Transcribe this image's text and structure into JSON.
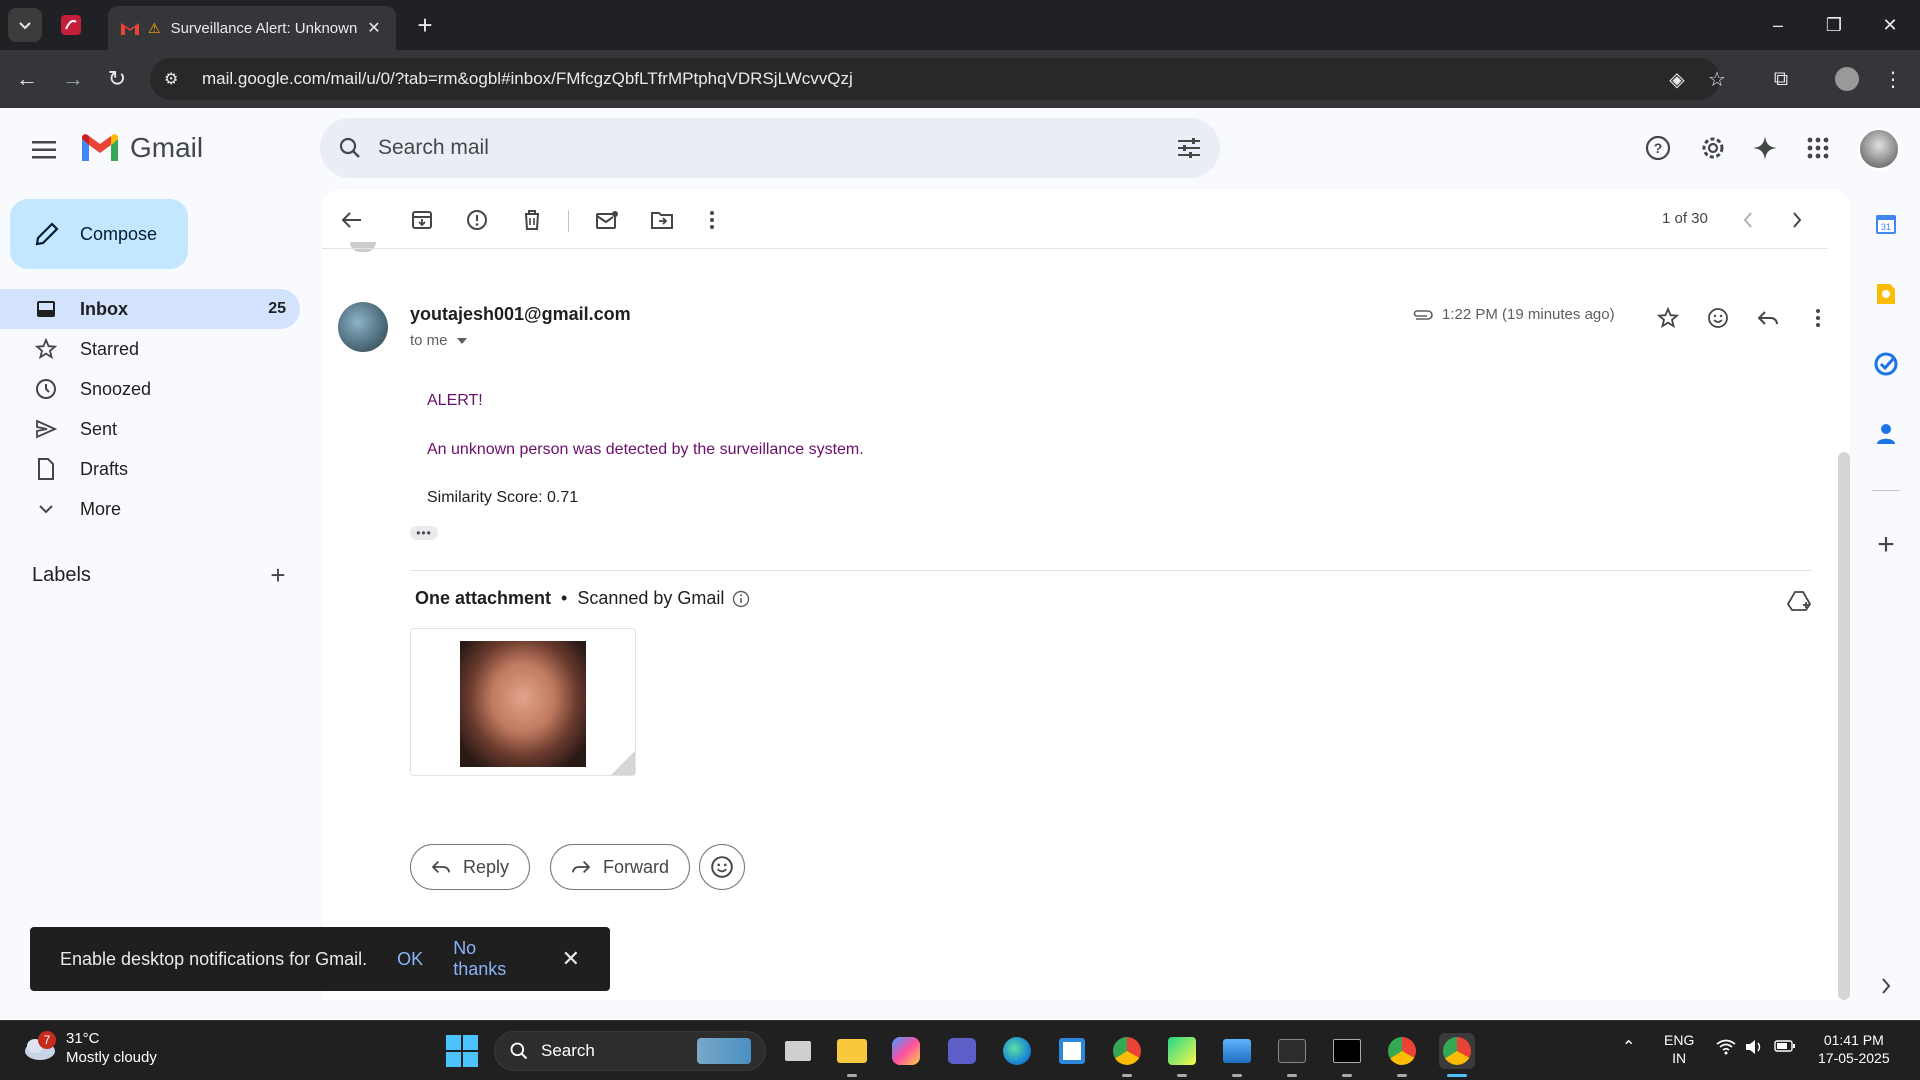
{
  "browser": {
    "tab_title": "Surveillance Alert: Unknown",
    "url": "mail.google.com/mail/u/0/?tab=rm&ogbl#inbox/FMfcgzQbfLTfrMPtphqVDRSjLWcvvQzj"
  },
  "gmail": {
    "wordmark": "Gmail",
    "search_placeholder": "Search mail",
    "compose_label": "Compose",
    "nav": [
      {
        "label": "Inbox",
        "count": "25",
        "icon": "inbox-icon"
      },
      {
        "label": "Starred",
        "count": "",
        "icon": "star-icon"
      },
      {
        "label": "Snoozed",
        "count": "",
        "icon": "clock-icon"
      },
      {
        "label": "Sent",
        "count": "",
        "icon": "send-icon"
      },
      {
        "label": "Drafts",
        "count": "",
        "icon": "draft-icon"
      },
      {
        "label": "More",
        "count": "",
        "icon": "chevron-down-icon"
      }
    ],
    "labels_header": "Labels",
    "pager": "1 of 30"
  },
  "message": {
    "sender": "youtajesh001@gmail.com",
    "to": "to me",
    "time": "1:22 PM (19 minutes ago)",
    "body": {
      "line1": "ALERT!",
      "line2": "An unknown person was detected by the surveillance system.",
      "line3": "Similarity Score: 0.71"
    },
    "attachments": {
      "count_label": "One attachment",
      "scanned": "Scanned by Gmail"
    },
    "reply_label": "Reply",
    "forward_label": "Forward"
  },
  "snackbar": {
    "message": "Enable desktop notifications for Gmail.",
    "ok": "OK",
    "no_thanks": "No thanks"
  },
  "taskbar": {
    "weather_temp": "31°C",
    "weather_desc": "Mostly cloudy",
    "weather_badge": "7",
    "search_label": "Search",
    "lang_top": "ENG",
    "lang_bottom": "IN",
    "time": "01:41 PM",
    "date": "17-05-2025"
  },
  "colors": {
    "accent": "#0b57d0",
    "compose_bg": "#c2e7ff",
    "active_nav_bg": "#d3e3fd",
    "alert_text": "#6b0f6b"
  }
}
